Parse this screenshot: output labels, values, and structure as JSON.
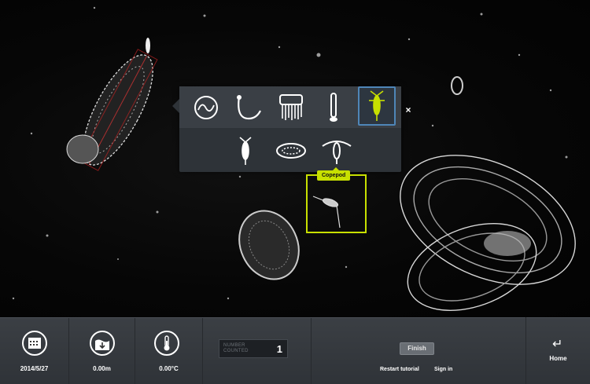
{
  "picker": {
    "row1": [
      {
        "name": "medusa-icon",
        "selected": false
      },
      {
        "name": "chaetognath-icon",
        "selected": false
      },
      {
        "name": "siphonophore-icon",
        "selected": false
      },
      {
        "name": "larvacean-icon",
        "selected": false
      },
      {
        "name": "shrimp-icon",
        "selected": true
      }
    ],
    "row2": [
      {
        "name": "larva-icon",
        "selected": false
      },
      {
        "name": "ctenophore-icon",
        "selected": false
      },
      {
        "name": "copepod-icon",
        "selected": false
      }
    ],
    "close_label": "×"
  },
  "tooltip": {
    "label": "Copepod"
  },
  "toolbar": {
    "date": "2014/5/27",
    "depth": "0.00m",
    "temperature": "0.00°C",
    "counter_label_line1": "NUMBER",
    "counter_label_line2": "COUNTED",
    "count": "1",
    "finish_label": "Finish",
    "restart_label": "Restart tutorial",
    "signin_label": "Sign in",
    "home_icon": "↵",
    "home_label": "Home"
  },
  "colors": {
    "highlight": "#c8e000",
    "selected_border": "#4f86b8",
    "toolbar_bg": "#353a3f"
  }
}
